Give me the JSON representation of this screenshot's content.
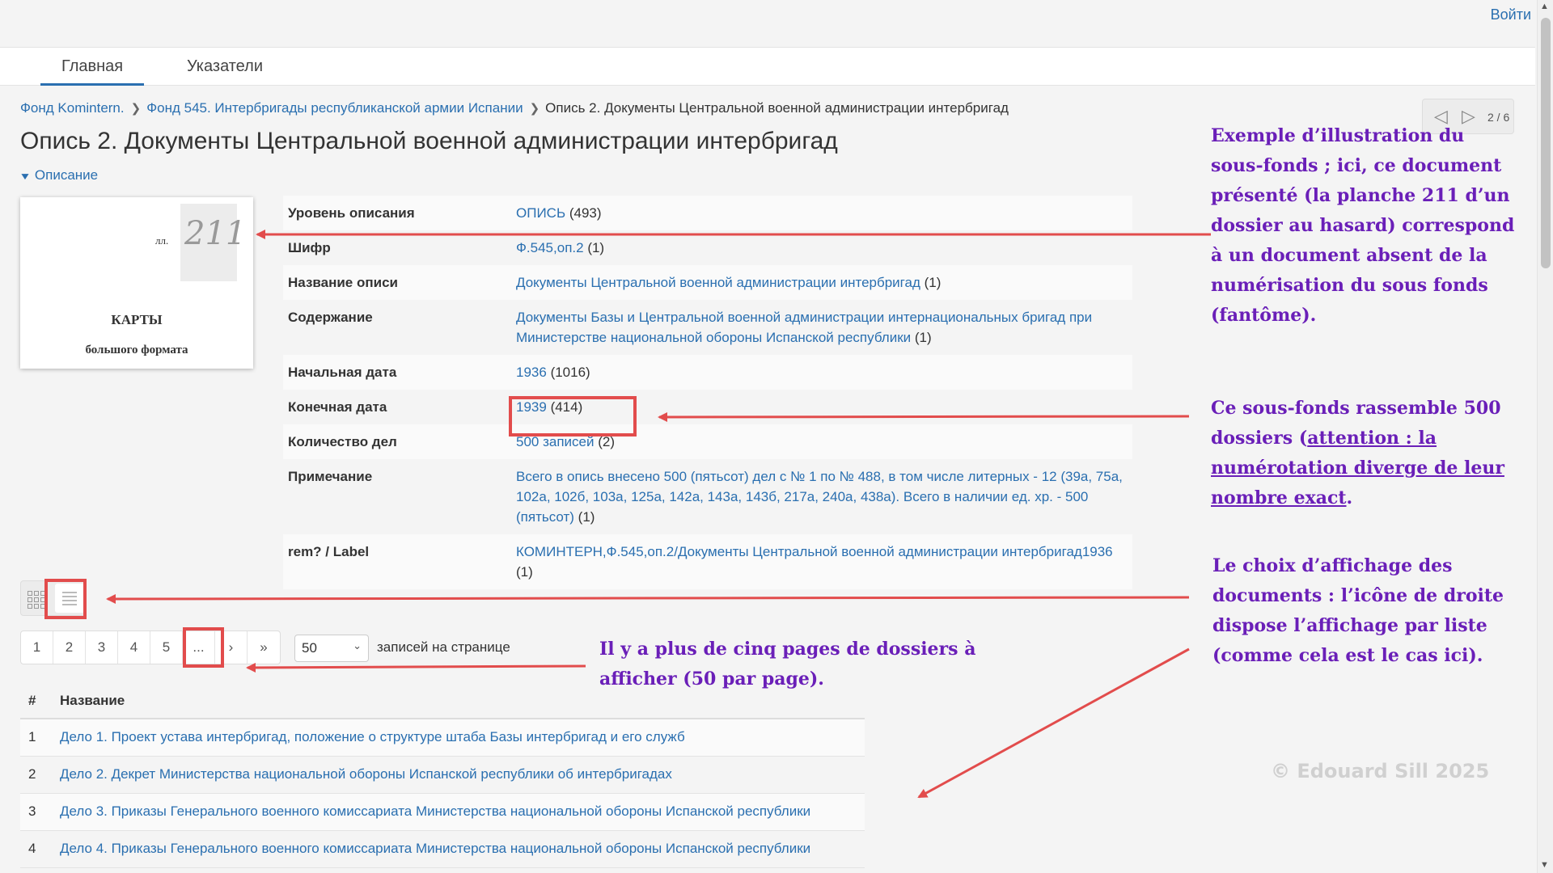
{
  "header": {
    "login_label": "Войти"
  },
  "nav": {
    "tabs": [
      {
        "label": "Главная",
        "active": true
      },
      {
        "label": "Указатели",
        "active": false
      }
    ]
  },
  "breadcrumb": {
    "items": [
      "Фонд Komintern.",
      "Фонд 545. Интербригады республиканской армии Испании"
    ],
    "current": "Опись 2. Документы Центральной военной администрации интербригад"
  },
  "page": {
    "title": "Опись 2. Документы Центральной военной администрации интербригад",
    "description_toggle": "Описание"
  },
  "doc_nav": {
    "prev_icon": "◁",
    "next_icon": "▷",
    "label": "2 / 6"
  },
  "thumbnail": {
    "folio_prefix": "лл.",
    "folio_number": "211",
    "title_line1": "КАРТЫ",
    "title_line2": "большого формата"
  },
  "properties": [
    {
      "key": "Уровень описания",
      "link": "ОПИСЬ",
      "count": "(493)"
    },
    {
      "key": "Шифр",
      "link": "Ф.545,оп.2",
      "count": "(1)"
    },
    {
      "key": "Название описи",
      "link": "Документы Центральной военной администрации интербригад",
      "count": "(1)"
    },
    {
      "key": "Содержание",
      "link": "Документы Базы и Центральной военной администрации интернациональных бригад при Министерстве национальной обороны Испанской республики",
      "count": "(1)"
    },
    {
      "key": "Начальная дата",
      "link": "1936",
      "count": "(1016)"
    },
    {
      "key": "Конечная дата",
      "link": "1939",
      "count": "(414)"
    },
    {
      "key": "Количество дел",
      "link": "500 записей",
      "count": "(2)"
    },
    {
      "key": "Примечание",
      "link": "Всего в опись внесено 500 (пятьсот) дел с № 1 по № 488, в том числе литерных - 12 (39а, 75а, 102а, 102б, 103а, 125а, 142а, 143а, 143б, 217а, 240а, 438а). Всего в наличии ед. хр. - 500 (пятьсот)",
      "count": "(1)"
    },
    {
      "key": "rem? / Label",
      "link": "КОМИНТЕРН,Ф.545,оп.2/Документы Центральной военной администрации интербригад1936",
      "count": "(1)"
    }
  ],
  "pagination": {
    "pages": [
      "1",
      "2",
      "3",
      "4",
      "5",
      "...",
      "›",
      "»"
    ],
    "per_page_value": "50",
    "per_page_label": "записей на странице"
  },
  "table": {
    "headers": {
      "num": "#",
      "name": "Название"
    },
    "rows": [
      {
        "num": "1",
        "name": "Дело 1. Проект устава интербригад, положение о структуре штаба Базы интербригад и его служб"
      },
      {
        "num": "2",
        "name": "Дело 2. Декрет Министерства национальной обороны Испанской республики об интербригадах"
      },
      {
        "num": "3",
        "name": "Дело 3. Приказы Генерального военного комиссариата Министерства национальной обороны Испанской республики"
      },
      {
        "num": "4",
        "name": "Дело 4. Приказы Генерального военного комиссариата Министерства национальной обороны Испанской республики"
      }
    ]
  },
  "annotations": {
    "note1": "Exemple d’illustration du sous-fonds ; ici, ce document présenté (la planche 211 d’un dossier au hasard) correspond à un document absent de la numérisation du sous fonds (fantôme).",
    "note2_plain": "Ce sous-fonds  rassemble 500 dossiers (",
    "note2_underline": "attention : la numérotation diverge de leur nombre exact",
    "note2_end": ".",
    "note3": "Le choix d’affichage des documents : l’icône de droite dispose l’affichage par liste (comme cela est le cas ici).",
    "note4": "Il y a plus de cinq pages de dossiers à afficher (50 par page).",
    "copyright": "© Edouard Sill 2025",
    "accent_color": "#e24c4c",
    "note_color": "#6a1fb8"
  },
  "colors": {
    "link": "#2a6fb0",
    "background": "#f4f4f4"
  }
}
